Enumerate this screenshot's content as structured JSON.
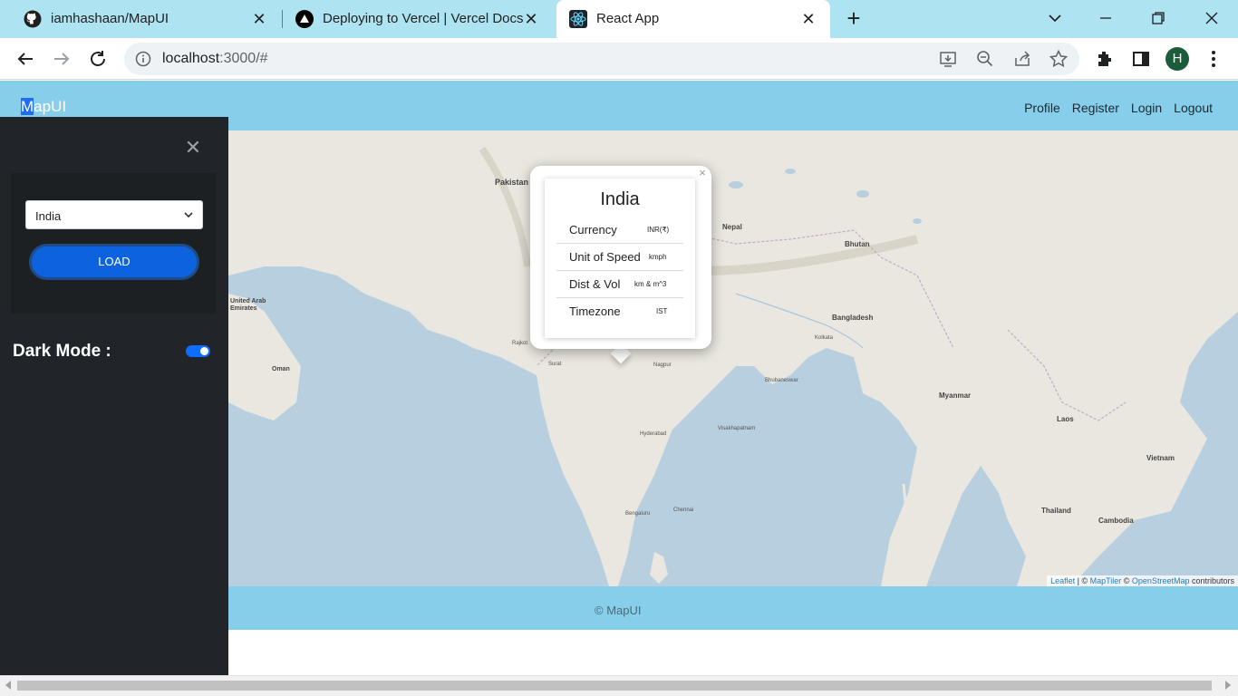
{
  "browser": {
    "tabs": [
      {
        "title": "iamhashaan/MapUI",
        "icon": "github-icon"
      },
      {
        "title": "Deploying to Vercel | Vercel Docs",
        "icon": "vercel-icon"
      },
      {
        "title": "React App",
        "icon": "react-icon",
        "active": true
      }
    ],
    "url_host": "localhost",
    "url_path": ":3000/#",
    "profile_initial": "H"
  },
  "app": {
    "brand": "MapUI",
    "brand_selected": "M",
    "brand_rest": "apUI",
    "nav": [
      "Profile",
      "Register",
      "Login",
      "Logout"
    ],
    "footer": "© MapUI"
  },
  "sidebar": {
    "country_select": "India",
    "load_button": "LOAD",
    "dark_mode_label": "Dark Mode :",
    "dark_mode_on": true
  },
  "popup": {
    "title": "India",
    "rows": [
      {
        "label": "Currency",
        "value": "INR(₹)"
      },
      {
        "label": "Unit of Speed",
        "value": "kmph"
      },
      {
        "label": "Dist & Vol",
        "value": "km & m^3"
      },
      {
        "label": "Timezone",
        "value": "IST"
      }
    ]
  },
  "map": {
    "labels": {
      "pakistan": "Pakistan",
      "nepal": "Nepal",
      "bhutan": "Bhutan",
      "bangladesh": "Bangladesh",
      "myanmar": "Myanmar",
      "laos": "Laos",
      "thailand": "Thailand",
      "vietnam": "Vietnam",
      "cambodia": "Cambodia",
      "uae": "United Arab Emirates",
      "oman": "Oman",
      "kolkata": "Kolkata",
      "nagpur": "Nagpur",
      "hyderabad": "Hyderabad",
      "bengaluru": "Bengaluru",
      "chennai": "Chennai",
      "surat": "Surat",
      "rajkot": "Rajkot",
      "bhubaneswar": "Bhubaneswar",
      "visakhapatnam": "Visakhapatnam"
    },
    "attribution": {
      "leaflet": "Leaflet",
      "sep1": " | © ",
      "maptiler": "MapTiler",
      "sep2": " © ",
      "osm": "OpenStreetMap",
      "suffix": " contributors"
    },
    "colors": {
      "water": "#b8cfe0",
      "land": "#e9e7df",
      "header": "#87ceeb"
    }
  }
}
